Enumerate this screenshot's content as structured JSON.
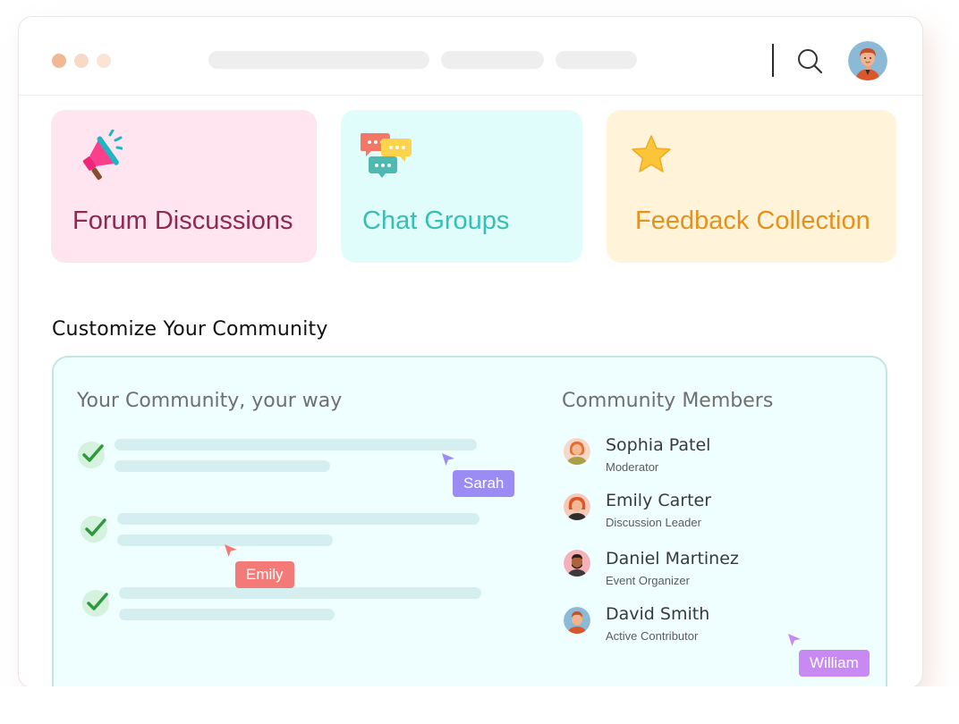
{
  "colors": {
    "window_dots": [
      "#f2b896",
      "#f8d9c8",
      "#fbe3d6"
    ],
    "forum_bg": "#ffe5f0",
    "forum_text": "#8e2a52",
    "chat_bg": "#e1fdfb",
    "chat_text": "#36bfb2",
    "feedback_bg": "#fff4d9",
    "feedback_text": "#e5911c",
    "sarah": "#9a8cf3",
    "emily": "#f47a78",
    "william": "#c88af2"
  },
  "header": {
    "icons": [
      "search-icon",
      "user-avatar"
    ]
  },
  "cards": [
    {
      "label": "Forum Discussions",
      "icon": "megaphone-icon"
    },
    {
      "label": "Chat Groups",
      "icon": "chat-bubbles-icon"
    },
    {
      "label": "Feedback Collection",
      "icon": "star-icon"
    }
  ],
  "section_title": "Customize Your Community",
  "panel": {
    "left_title": "Your Community, your way",
    "right_title": "Community Members",
    "cursors": [
      {
        "name": "Sarah"
      },
      {
        "name": "Emily"
      },
      {
        "name": "William"
      }
    ],
    "members": [
      {
        "name": "Sophia Patel",
        "role": "Moderator"
      },
      {
        "name": "Emily Carter",
        "role": "Discussion Leader"
      },
      {
        "name": "Daniel Martinez",
        "role": "Event Organizer"
      },
      {
        "name": "David Smith",
        "role": "Active Contributor"
      }
    ]
  }
}
